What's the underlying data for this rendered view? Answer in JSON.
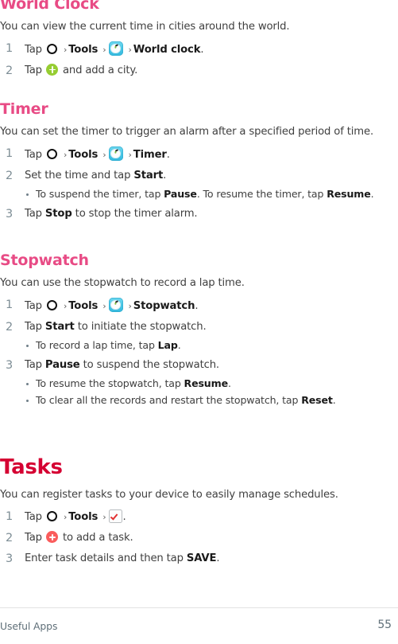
{
  "page": {
    "footer_label": "Useful Apps",
    "page_number": "55"
  },
  "colors": {
    "section_heading": "#d50032",
    "sub_heading": "#e84b85",
    "body_text": "#3f3f3f",
    "step_number": "#7e8e96",
    "plus_green": "#96cd32",
    "plus_red": "#fa5c5c",
    "clock_icon_bg": "#49c6e6",
    "task_check": "#e23030"
  },
  "sections": {
    "world_clock": {
      "heading": "World Clock",
      "intro": "You can view the current time in cities around the world.",
      "steps": [
        {
          "number": "1",
          "parts": {
            "tap": "Tap",
            "tools": "Tools",
            "target": "World clock",
            "period": "."
          }
        },
        {
          "number": "2",
          "parts": {
            "tap": "Tap",
            "after": "and add a city."
          }
        }
      ]
    },
    "timer": {
      "heading": "Timer",
      "intro": "You can set the timer to trigger an alarm after a specified period of time.",
      "steps": [
        {
          "number": "1",
          "parts": {
            "tap": "Tap",
            "tools": "Tools",
            "target": "Timer",
            "period": "."
          }
        },
        {
          "number": "2",
          "parts": {
            "lead": "Set the time and tap ",
            "bold": "Start",
            "period": "."
          },
          "subs": [
            {
              "lead": "To suspend the timer, tap ",
              "bold1": "Pause",
              "mid": ". To resume the timer, tap ",
              "bold2": "Resume",
              "period": "."
            }
          ]
        },
        {
          "number": "3",
          "parts": {
            "lead": "Tap ",
            "bold": "Stop",
            "tail": " to stop the timer alarm."
          }
        }
      ]
    },
    "stopwatch": {
      "heading": "Stopwatch",
      "intro": "You can use the stopwatch to record a lap time.",
      "steps": [
        {
          "number": "1",
          "parts": {
            "tap": "Tap",
            "tools": "Tools",
            "target": "Stopwatch",
            "period": "."
          }
        },
        {
          "number": "2",
          "parts": {
            "lead": "Tap ",
            "bold": "Start",
            "tail": " to initiate the stopwatch."
          },
          "subs": [
            {
              "lead": "To record a lap time, tap ",
              "bold1": "Lap",
              "period": "."
            }
          ]
        },
        {
          "number": "3",
          "parts": {
            "lead": "Tap ",
            "bold": "Pause",
            "tail": " to suspend the stopwatch."
          },
          "subs": [
            {
              "lead": "To resume the stopwatch, tap ",
              "bold1": "Resume",
              "period": "."
            },
            {
              "lead": "To clear all the records and restart the stopwatch, tap ",
              "bold1": "Reset",
              "period": "."
            }
          ]
        }
      ]
    },
    "tasks": {
      "heading": "Tasks",
      "intro": "You can register tasks to your device to easily manage schedules.",
      "steps": [
        {
          "number": "1",
          "parts": {
            "tap": "Tap",
            "tools": "Tools",
            "period": "."
          }
        },
        {
          "number": "2",
          "parts": {
            "tap": "Tap",
            "after": "to add a task."
          }
        },
        {
          "number": "3",
          "parts": {
            "lead": "Enter task details and then tap ",
            "bold": "SAVE",
            "period": "."
          }
        }
      ]
    }
  },
  "icons": {
    "home_key": "home-circle-icon",
    "clock_app": "clock-app-icon",
    "tasks_app": "tasks-checkbox-icon",
    "add_green": "add-plus-green-icon",
    "add_red": "add-plus-red-icon",
    "chevron": "›"
  }
}
